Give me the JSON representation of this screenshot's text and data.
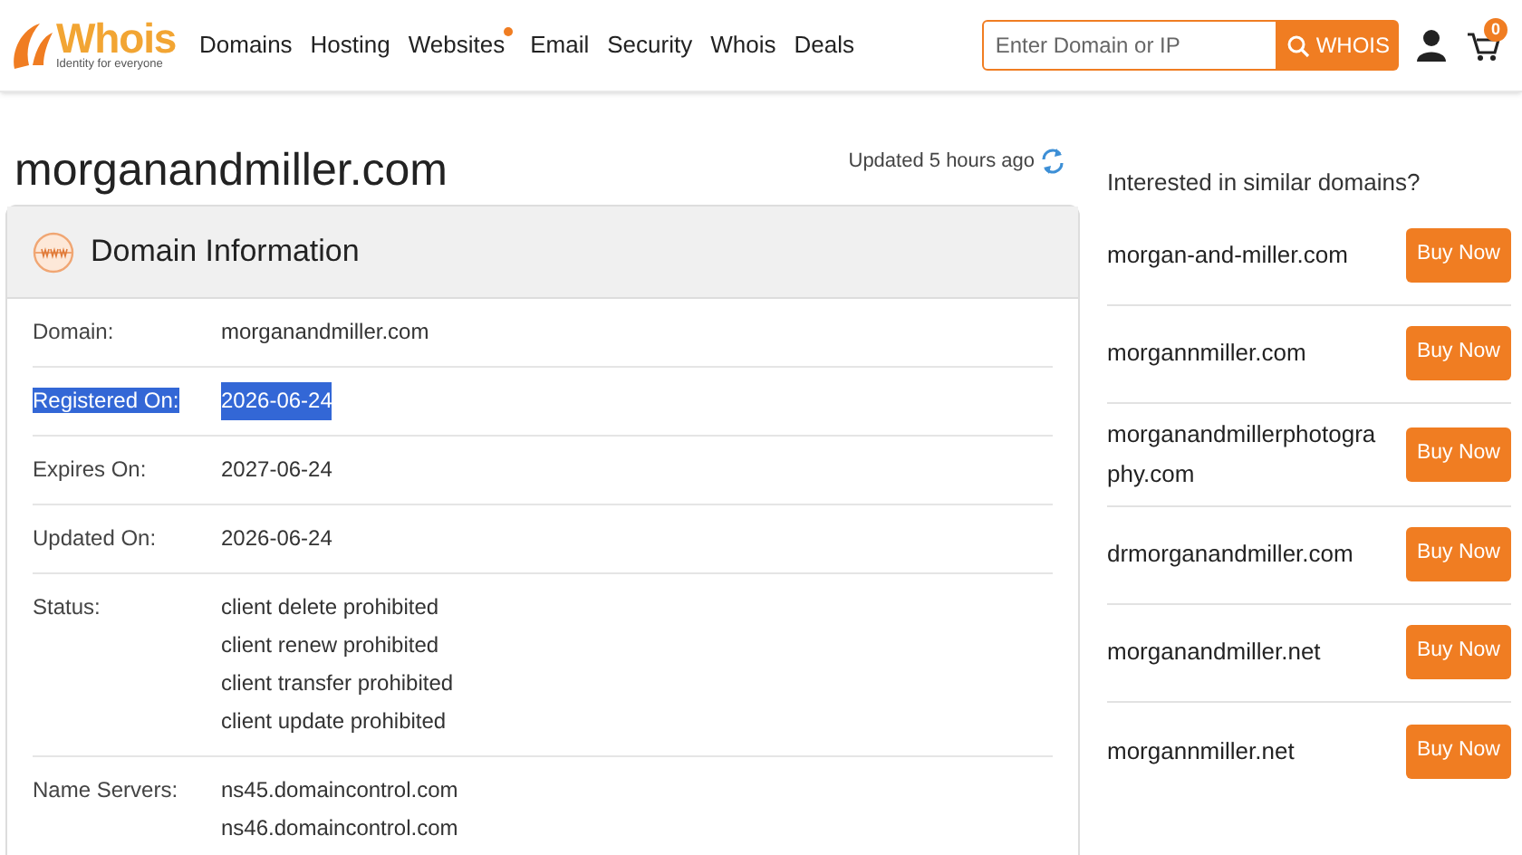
{
  "header": {
    "logo": {
      "name": "Whois",
      "tagline": "Identity for everyone"
    },
    "nav": [
      {
        "label": "Domains",
        "badge": false
      },
      {
        "label": "Hosting",
        "badge": false
      },
      {
        "label": "Websites",
        "badge": true
      },
      {
        "label": "Email",
        "badge": false
      },
      {
        "label": "Security",
        "badge": false
      },
      {
        "label": "Whois",
        "badge": false
      },
      {
        "label": "Deals",
        "badge": false
      }
    ],
    "search": {
      "placeholder": "Enter Domain or IP",
      "button": "WHOIS"
    },
    "cart_count": "0"
  },
  "domain": {
    "title": "morganandmiller.com",
    "updated": "Updated 5 hours ago"
  },
  "card": {
    "title": "Domain Information",
    "rows": [
      {
        "label": "Domain:",
        "values": [
          "morganandmiller.com"
        ],
        "highlighted": false
      },
      {
        "label": "Registered On:",
        "values": [
          "2026-06-24"
        ],
        "highlighted": true
      },
      {
        "label": "Expires On:",
        "values": [
          "2027-06-24"
        ],
        "highlighted": false
      },
      {
        "label": "Updated On:",
        "values": [
          "2026-06-24"
        ],
        "highlighted": false
      },
      {
        "label": "Status:",
        "values": [
          "client delete prohibited",
          "client renew prohibited",
          "client transfer prohibited",
          "client update prohibited"
        ],
        "highlighted": false
      },
      {
        "label": "Name Servers:",
        "values": [
          "ns45.domaincontrol.com",
          "ns46.domaincontrol.com"
        ],
        "highlighted": false
      }
    ]
  },
  "similar": {
    "heading": "Interested in similar domains?",
    "items": [
      {
        "domain": "morgan-and-miller.com",
        "button": "Buy Now"
      },
      {
        "domain": "morgannmiller.com",
        "button": "Buy Now"
      },
      {
        "domain": "morganandmillerphotography.com",
        "button": "Buy Now"
      },
      {
        "domain": "drmorganandmiller.com",
        "button": "Buy Now"
      },
      {
        "domain": "morganandmiller.net",
        "button": "Buy Now"
      },
      {
        "domain": "morgannmiller.net",
        "button": "Buy Now"
      }
    ]
  }
}
